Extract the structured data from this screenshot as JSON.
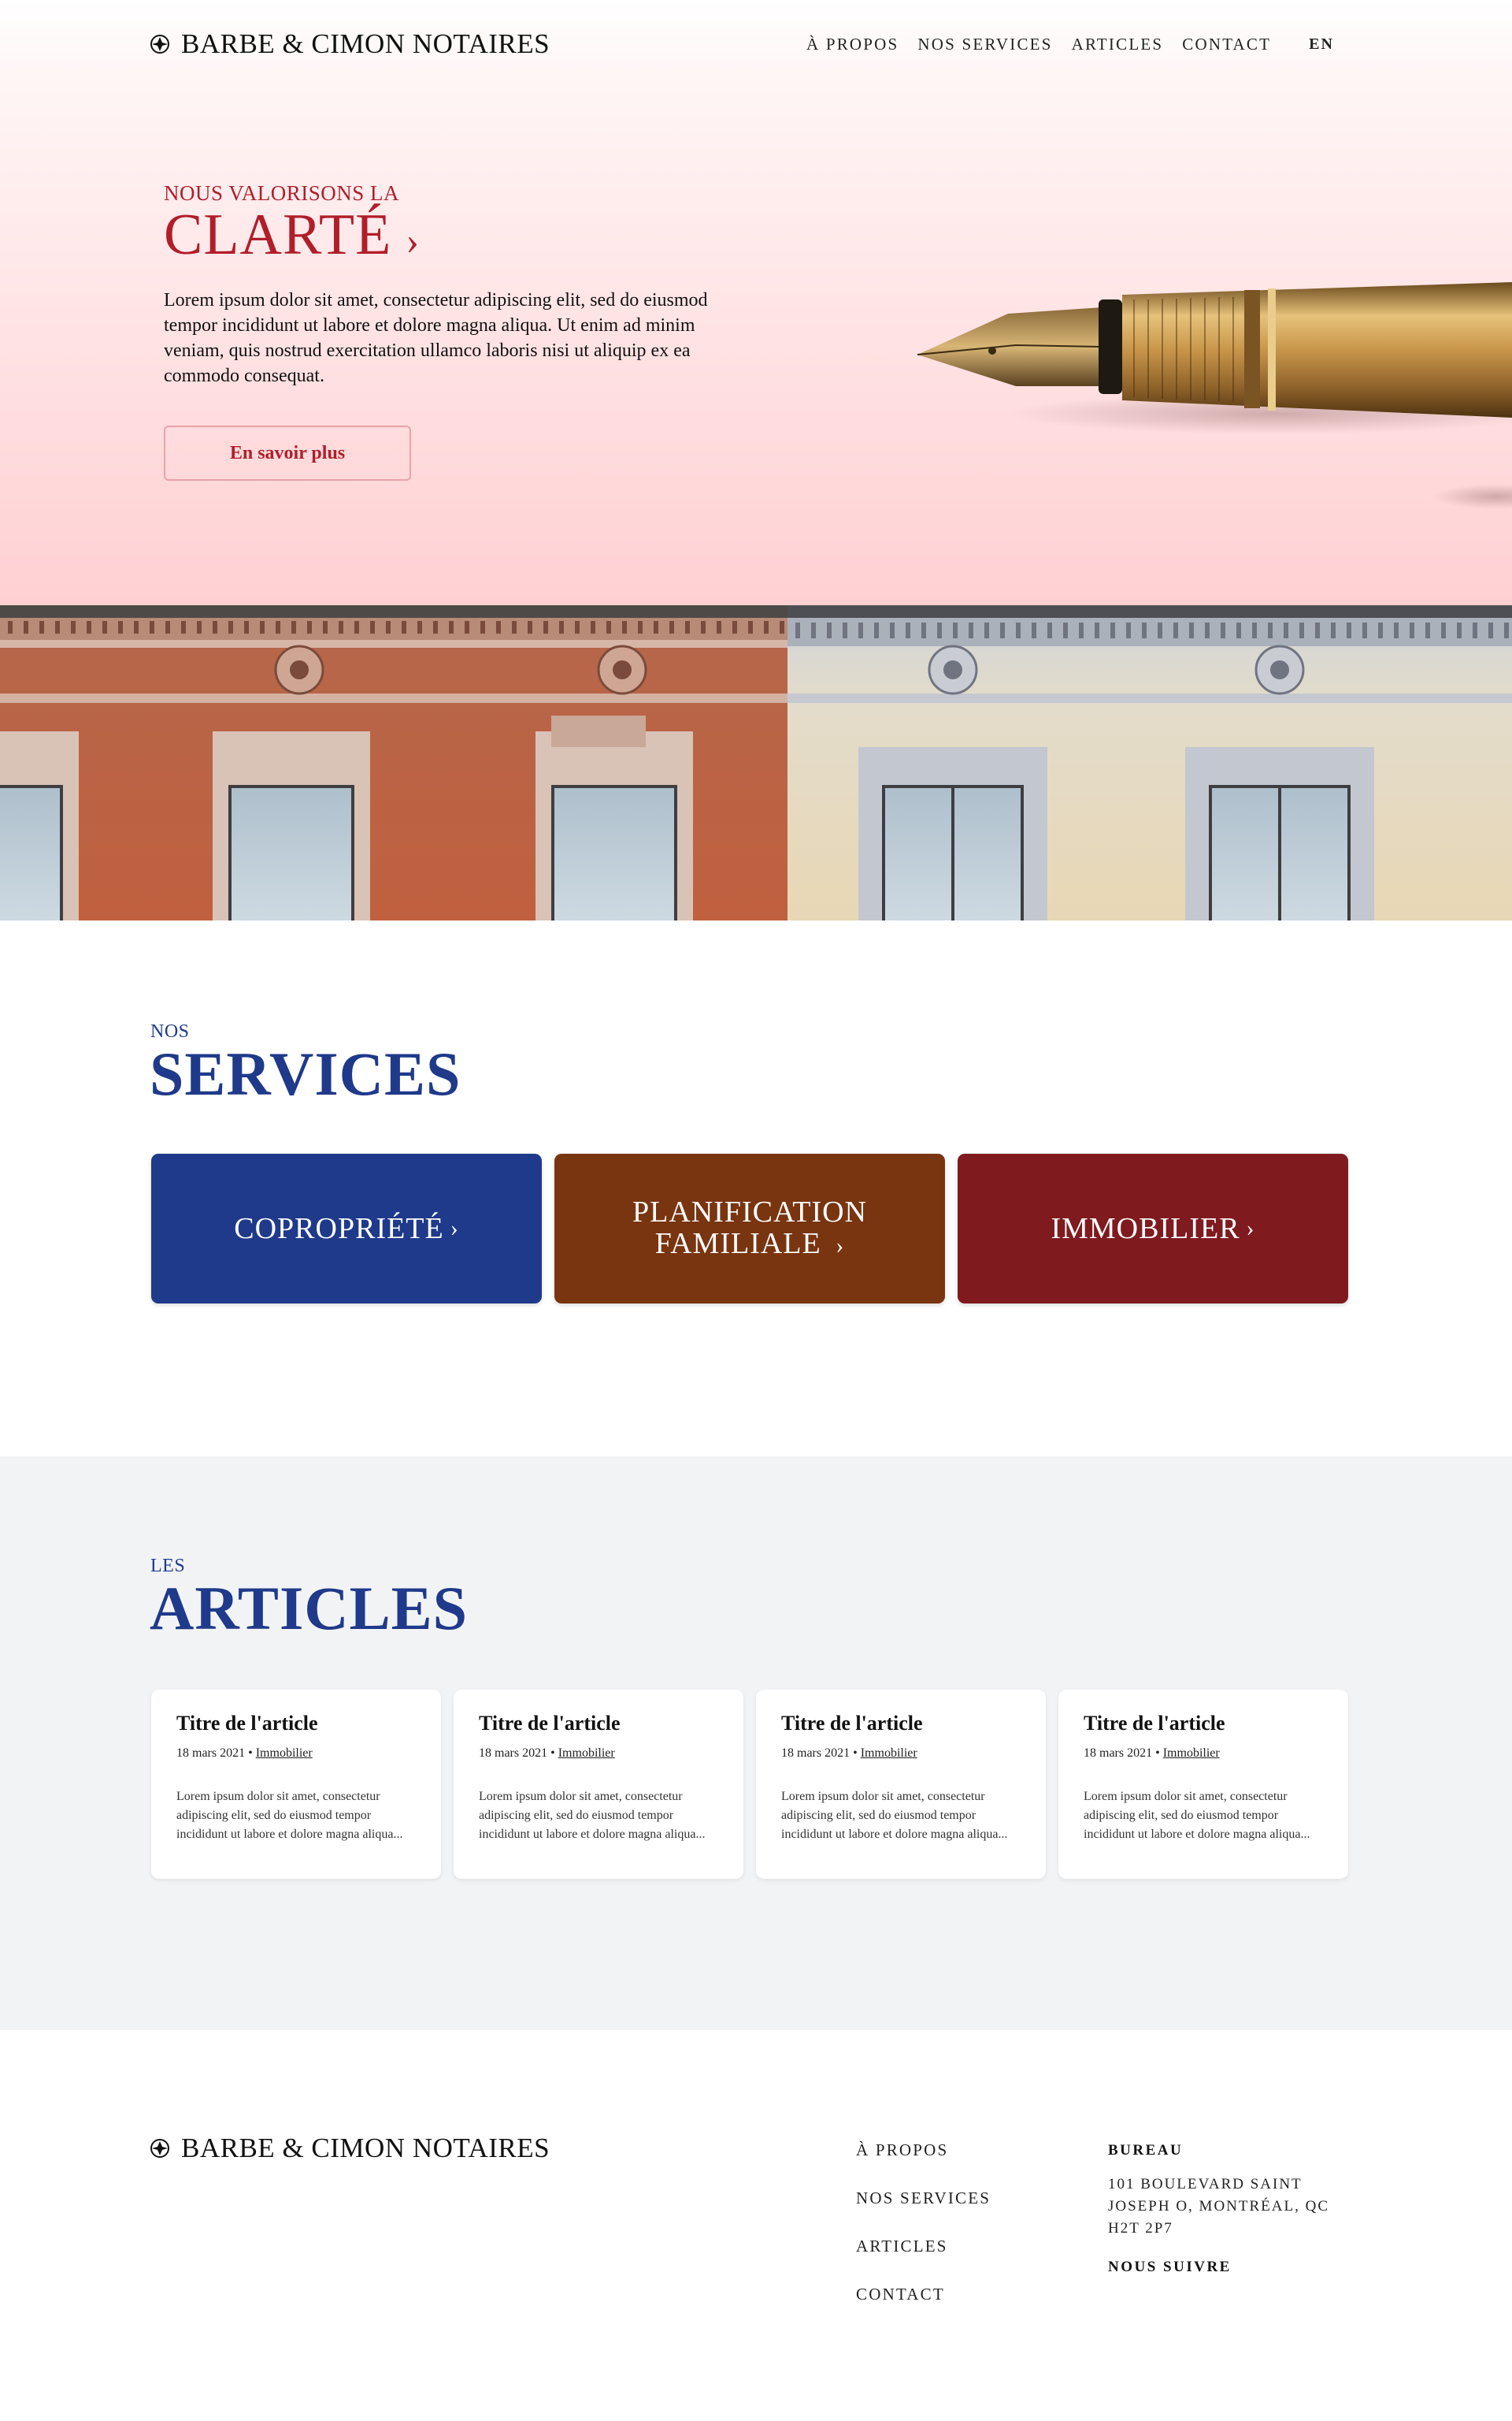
{
  "brand": {
    "name": "BARBE & CIMON NOTAIRES"
  },
  "nav": {
    "items": [
      "À PROPOS",
      "NOS SERVICES",
      "ARTICLES",
      "CONTACT"
    ],
    "lang": "EN"
  },
  "hero": {
    "eyebrow": "NOUS VALORISONS LA",
    "title": "CLARTÉ",
    "title_chevron": "›",
    "text": "Lorem ipsum dolor sit amet, consectetur adipiscing elit, sed do eiusmod tempor incididunt ut labore et dolore magna aliqua. Ut enim ad minim veniam, quis nostrud exercitation ullamco laboris nisi ut aliquip ex ea commodo consequat.",
    "button": "En savoir plus"
  },
  "services": {
    "eyebrow": "NOS",
    "title": "SERVICES",
    "items": [
      {
        "label": "COPROPRIÉTÉ",
        "chevron": "›",
        "color": "#1f3a8a"
      },
      {
        "label_line1": "PLANIFICATION",
        "label_line2": "FAMILIALE",
        "chevron": "›",
        "color": "#793510"
      },
      {
        "label": "IMMOBILIER",
        "chevron": "›",
        "color": "#7f1a1f"
      }
    ]
  },
  "articles": {
    "eyebrow": "LES",
    "title": "ARTICLES",
    "items": [
      {
        "title": "Titre de l'article",
        "date": "18 mars 2021",
        "separator": "•",
        "category": "Immobilier",
        "excerpt": "Lorem ipsum dolor sit amet, consectetur adipiscing elit, sed do eiusmod tempor incididunt ut labore et dolore magna aliqua..."
      },
      {
        "title": "Titre de l'article",
        "date": "18 mars 2021",
        "separator": "•",
        "category": "Immobilier",
        "excerpt": "Lorem ipsum dolor sit amet, consectetur adipiscing elit, sed do eiusmod tempor incididunt ut labore et dolore magna aliqua..."
      },
      {
        "title": "Titre de l'article",
        "date": "18 mars 2021",
        "separator": "•",
        "category": "Immobilier",
        "excerpt": "Lorem ipsum dolor sit amet, consectetur adipiscing elit, sed do eiusmod tempor incididunt ut labore et dolore magna aliqua..."
      },
      {
        "title": "Titre de l'article",
        "date": "18 mars 2021",
        "separator": "•",
        "category": "Immobilier",
        "excerpt": "Lorem ipsum dolor sit amet, consectetur adipiscing elit, sed do eiusmod tempor incididunt ut labore et dolore magna aliqua..."
      }
    ]
  },
  "footer": {
    "nav": [
      "À PROPOS",
      "NOS SERVICES",
      "ARTICLES",
      "CONTACT"
    ],
    "office_heading": "BUREAU",
    "address": "101 BOULEVARD SAINT JOSEPH O, MONTRÉAL, QC H2T 2P7",
    "follow_heading": "NOUS SUIVRE"
  },
  "colors": {
    "accent_red": "#b01e2a",
    "accent_blue": "#1f3a8a",
    "service_brown": "#793510",
    "service_red": "#7f1a1f"
  }
}
